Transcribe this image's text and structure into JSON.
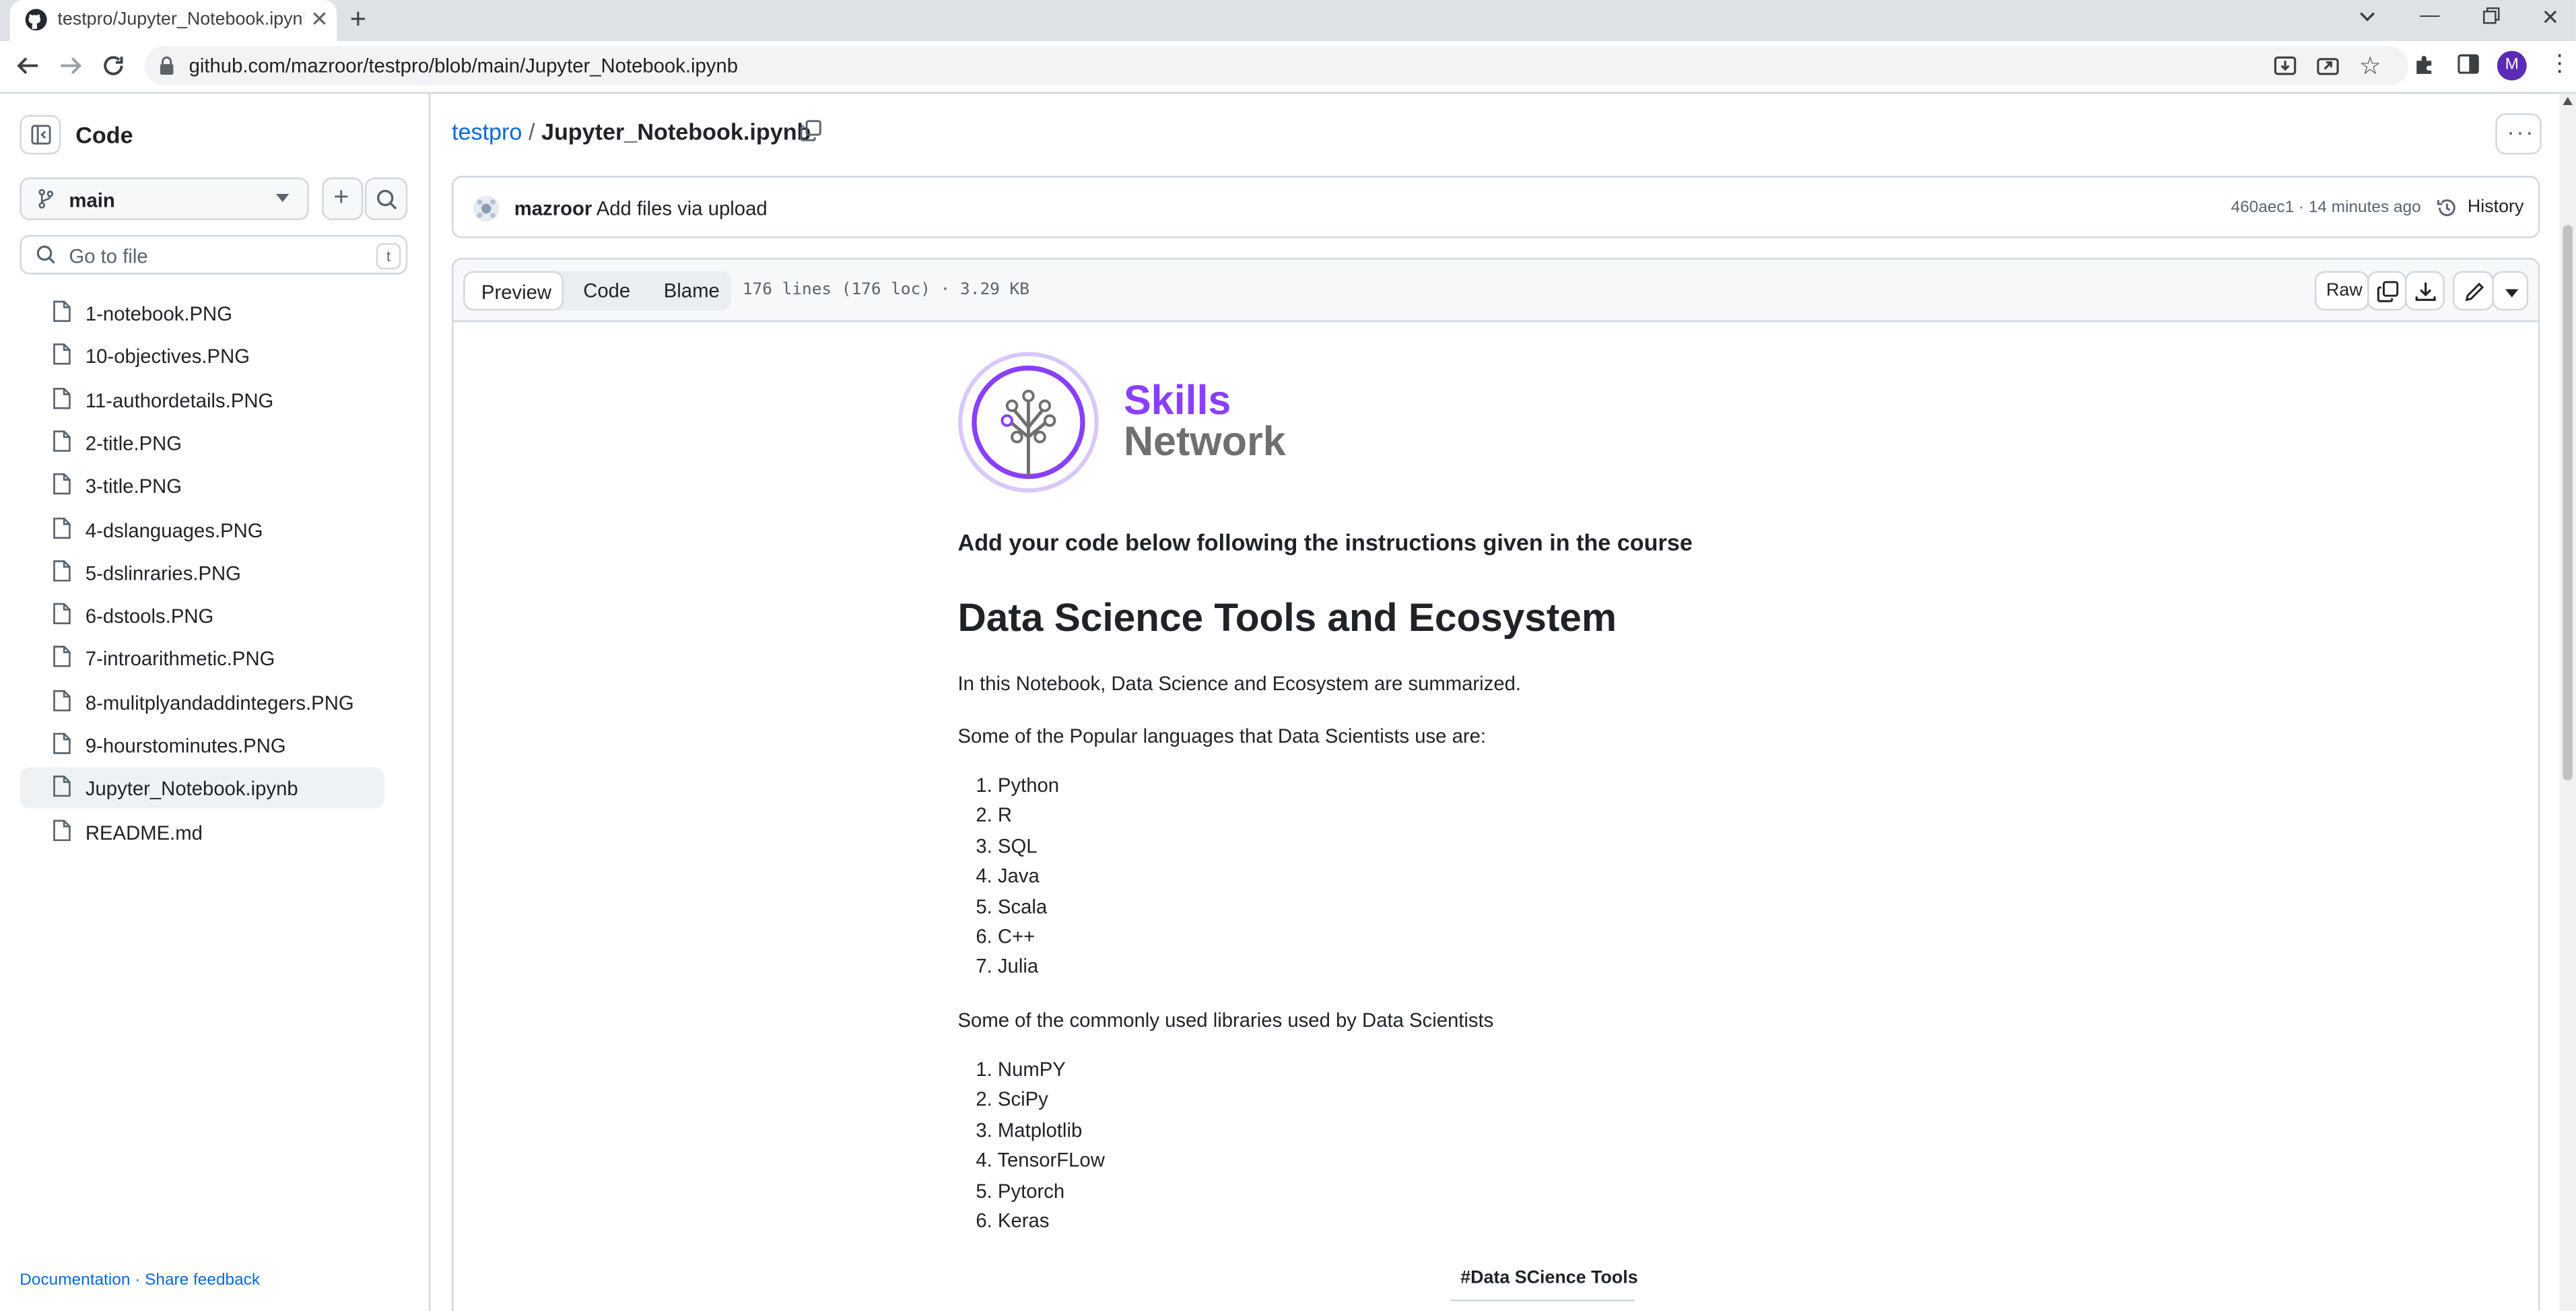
{
  "browser": {
    "tab_title": "testpro/Jupyter_Notebook.ipynb",
    "url": "github.com/mazroor/testpro/blob/main/Jupyter_Notebook.ipynb",
    "profile_initial": "M"
  },
  "sidebar": {
    "title": "Code",
    "branch": "main",
    "go_to_file_placeholder": "Go to file",
    "go_to_file_shortcut": "t",
    "files": [
      {
        "name": "1-notebook.PNG"
      },
      {
        "name": "10-objectives.PNG"
      },
      {
        "name": "11-authordetails.PNG"
      },
      {
        "name": "2-title.PNG"
      },
      {
        "name": "3-title.PNG"
      },
      {
        "name": "4-dslanguages.PNG"
      },
      {
        "name": "5-dslinraries.PNG"
      },
      {
        "name": "6-dstools.PNG"
      },
      {
        "name": "7-introarithmetic.PNG"
      },
      {
        "name": "8-mulitplyandaddintegers.PNG"
      },
      {
        "name": "9-hourstominutes.PNG"
      },
      {
        "name": "Jupyter_Notebook.ipynb",
        "selected": true
      },
      {
        "name": "README.md"
      }
    ],
    "footer_documentation": "Documentation",
    "footer_separator": "·",
    "footer_feedback": "Share feedback"
  },
  "breadcrumb": {
    "repo": "testpro",
    "separator": "/",
    "file": "Jupyter_Notebook.ipynb"
  },
  "commit": {
    "author": "mazroor",
    "message": "Add files via upload",
    "sha_time": "460aec1 · 14 minutes ago",
    "history_label": "History"
  },
  "file_toolbar": {
    "tabs": [
      "Preview",
      "Code",
      "Blame"
    ],
    "active_tab": "Preview",
    "stats": "176 lines (176 loc) · 3.29 KB",
    "raw_label": "Raw"
  },
  "notebook": {
    "logo_line1": "Skills",
    "logo_line2": "Network",
    "intro_heading": "Add your code below following the instructions given in the course",
    "title": "Data Science Tools and Ecosystem",
    "summary": "In this Notebook, Data Science and Ecosystem are summarized.",
    "languages_intro": "Some of the Popular languages that Data Scientists use are:",
    "languages": [
      "Python",
      "R",
      "SQL",
      "Java",
      "Scala",
      "C++",
      "Julia"
    ],
    "libraries_intro": "Some of the commonly used libraries used by Data Scientists",
    "libraries": [
      "NumPY",
      "SciPy",
      "Matplotlib",
      "TensorFLow",
      "Pytorch",
      "Keras"
    ],
    "table_header": "#Data SCience Tools"
  },
  "colors": {
    "link": "#0969da",
    "logo_purple": "#8a3ffc",
    "logo_gray": "#6f6f6f",
    "border": "#d0d7de"
  }
}
